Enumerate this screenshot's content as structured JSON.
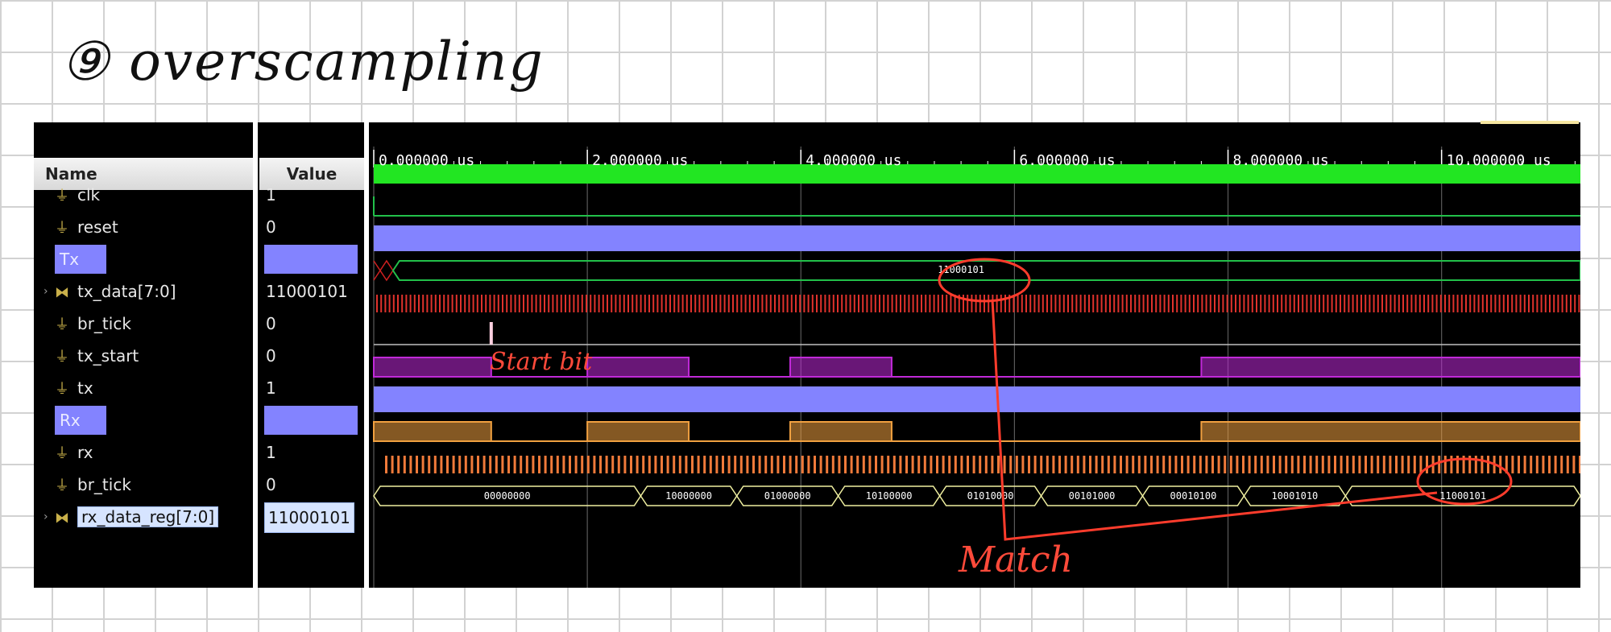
{
  "annotation": {
    "heading": "⑨ overscampling",
    "start_bit": "Start bit",
    "match": "Match"
  },
  "headers": {
    "name": "Name",
    "value": "Value"
  },
  "signals": [
    {
      "name": "clk",
      "value": "1",
      "icon": "wire-icon",
      "kind": "signal"
    },
    {
      "name": "reset",
      "value": "0",
      "icon": "wire-icon",
      "kind": "signal"
    },
    {
      "name": "Tx",
      "value": "",
      "icon": "",
      "kind": "group"
    },
    {
      "name": "tx_data[7:0]",
      "value": "11000101",
      "icon": "bus-icon",
      "kind": "bus"
    },
    {
      "name": "br_tick",
      "value": "0",
      "icon": "wire-icon",
      "kind": "signal"
    },
    {
      "name": "tx_start",
      "value": "0",
      "icon": "wire-icon",
      "kind": "signal"
    },
    {
      "name": "tx",
      "value": "1",
      "icon": "wire-icon",
      "kind": "signal"
    },
    {
      "name": "Rx",
      "value": "",
      "icon": "",
      "kind": "group"
    },
    {
      "name": "rx",
      "value": "1",
      "icon": "wire-icon",
      "kind": "signal"
    },
    {
      "name": "br_tick",
      "value": "0",
      "icon": "wire-icon",
      "kind": "signal"
    },
    {
      "name": "rx_data_reg[7:0]",
      "value": "11000101",
      "icon": "bus-icon",
      "kind": "bus-selected"
    }
  ],
  "timeline": {
    "unit": "us",
    "ticks": [
      "0.000000 us",
      "2.000000 us",
      "4.000000 us",
      "6.000000 us",
      "8.000000 us",
      "10.000000 us"
    ],
    "tick_values": [
      0,
      2,
      4,
      6,
      8,
      10
    ],
    "end": 11.3
  },
  "colors": {
    "clk": "#22e622",
    "group": "#8383ff",
    "tx_data": "#22c04a",
    "br_tick": "#e0322c",
    "tx_start": "#c02ad8",
    "rx_wave": "#f0a040",
    "rx_tick": "#f07a3a",
    "bus_rx": "#f0f0a0",
    "highlight": "#ff3c2c"
  },
  "waves": {
    "tx_data_label": "11000101",
    "tx_start_pulse_us": 1.1,
    "tx_high_segments": [
      [
        0,
        1.1
      ],
      [
        2.0,
        2.95
      ],
      [
        3.9,
        4.85
      ],
      [
        7.75,
        11.3
      ]
    ],
    "rx_high_segments": [
      [
        0,
        1.1
      ],
      [
        2.0,
        2.95
      ],
      [
        3.9,
        4.85
      ],
      [
        7.75,
        11.3
      ]
    ],
    "rx_bus": [
      {
        "start": 0,
        "end": 2.5,
        "label": "00000000"
      },
      {
        "start": 2.5,
        "end": 3.4,
        "label": "10000000"
      },
      {
        "start": 3.4,
        "end": 4.35,
        "label": "01000000"
      },
      {
        "start": 4.35,
        "end": 5.3,
        "label": "10100000"
      },
      {
        "start": 5.3,
        "end": 6.25,
        "label": "01010000"
      },
      {
        "start": 6.25,
        "end": 7.2,
        "label": "00101000"
      },
      {
        "start": 7.2,
        "end": 8.15,
        "label": "00010100"
      },
      {
        "start": 8.15,
        "end": 9.1,
        "label": "10001010"
      },
      {
        "start": 9.1,
        "end": 11.3,
        "label": "11000101"
      }
    ]
  }
}
